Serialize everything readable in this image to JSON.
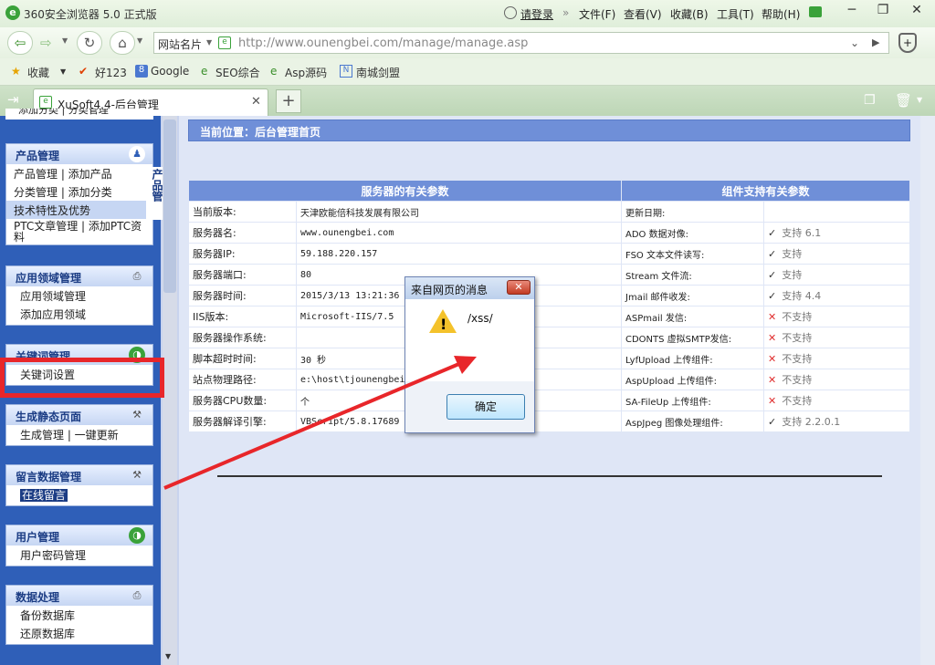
{
  "window": {
    "title": "360安全浏览器 5.0 正式版",
    "login": "请登录",
    "logo_glyph": "e"
  },
  "menu": [
    "文件(F)",
    "查看(V)",
    "收藏(B)",
    "工具(T)",
    "帮助(H)"
  ],
  "nav": {
    "site_prefix": "网站名片",
    "url": "http://www.ounengbei.com/manage/manage.asp"
  },
  "bookmarks": [
    "收藏",
    "好123",
    "Google",
    "SEO综合",
    "Asp源码",
    "南城剑盟"
  ],
  "tab": {
    "title": "XuSoft4.4-后台管理"
  },
  "sidebar": {
    "top_partial": "添加分类 | 分类管理",
    "groups": [
      {
        "title": "产品管理",
        "items": [
          "产品管理 | 添加产品",
          "分类管理 | 添加分类",
          "技术特性及优势",
          "PTC文章管理 | 添加PTC资料"
        ]
      },
      {
        "title": "应用领域管理",
        "items": [
          "应用领域管理",
          "添加应用领域"
        ]
      },
      {
        "title": "关键词管理",
        "items": [
          "关键词设置"
        ]
      },
      {
        "title": "生成静态页面",
        "items": [
          "生成管理 | 一键更新"
        ]
      },
      {
        "title": "留言数据管理",
        "items": [
          "在线留言"
        ]
      },
      {
        "title": "用户管理",
        "items": [
          "用户密码管理"
        ]
      },
      {
        "title": "数据处理",
        "items": [
          "备份数据库",
          "还原数据库"
        ]
      }
    ],
    "floating_label": "产品管"
  },
  "main": {
    "location": "当前位置：后台管理首页",
    "server_header": "服务器的有关参数",
    "component_header": "组件支持有关参数",
    "server_rows": [
      [
        "当前版本:",
        "天津欧能倍科技发展有限公司"
      ],
      [
        "服务器名:",
        "www.ounengbei.com"
      ],
      [
        "服务器IP:",
        "59.188.220.157"
      ],
      [
        "服务器端口:",
        "80"
      ],
      [
        "服务器时间:",
        "2015/3/13 13:21:36"
      ],
      [
        "IIS版本:",
        "Microsoft-IIS/7.5"
      ],
      [
        "服务器操作系统:",
        ""
      ],
      [
        "脚本超时时间:",
        "30 秒"
      ],
      [
        "站点物理路径:",
        "e:\\host\\tjounengbei"
      ],
      [
        "服务器CPU数量:",
        "个"
      ],
      [
        "服务器解译引擎:",
        "VBScript/5.8.17689"
      ]
    ],
    "component_rows": [
      {
        "name": "更新日期:",
        "status": "",
        "mark": ""
      },
      {
        "name": "ADO 数据对像:",
        "status": "支持 6.1",
        "mark": "✓"
      },
      {
        "name": "FSO 文本文件读写:",
        "status": "支持",
        "mark": "✓"
      },
      {
        "name": "Stream 文件流:",
        "status": "支持",
        "mark": "✓"
      },
      {
        "name": "Jmail 邮件收发:",
        "status": "支持 4.4",
        "mark": "✓"
      },
      {
        "name": "ASPmail 发信:",
        "status": "不支持",
        "mark": "✕"
      },
      {
        "name": "CDONTS 虚拟SMTP发信:",
        "status": "不支持",
        "mark": "✕"
      },
      {
        "name": "LyfUpload 上传组件:",
        "status": "不支持",
        "mark": "✕"
      },
      {
        "name": "AspUpload 上传组件:",
        "status": "不支持",
        "mark": "✕"
      },
      {
        "name": "SA-FileUp 上传组件:",
        "status": "不支持",
        "mark": "✕"
      },
      {
        "name": "AspJpeg 图像处理组件:",
        "status": "支持 2.2.0.1",
        "mark": "✓"
      }
    ]
  },
  "dialog": {
    "title": "来自网页的消息",
    "message": "/xss/",
    "ok": "确定",
    "close_glyph": "✕",
    "warn_glyph": "!"
  },
  "colors": {
    "annotation": "#e8262a",
    "header_blue": "#6f8fd8"
  }
}
